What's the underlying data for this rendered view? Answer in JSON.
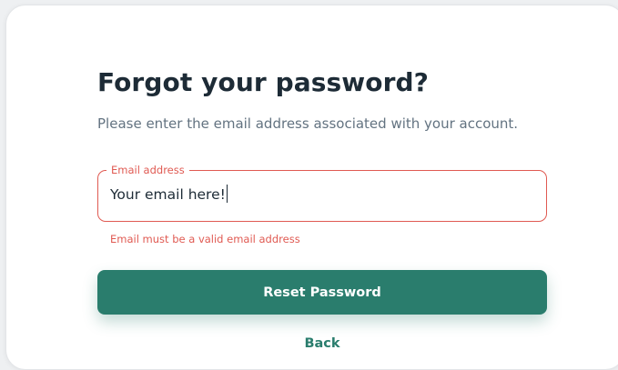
{
  "form": {
    "title": "Forgot your password?",
    "subtitle": "Please enter the email address associated with your account.",
    "email_field": {
      "label": "Email address",
      "value": "Your email here!",
      "error": "Email must be a valid email address"
    },
    "submit_label": "Reset Password",
    "back_label": "Back"
  },
  "colors": {
    "accent": "#2a7d6d",
    "error": "#e05a52",
    "heading": "#1d2b36",
    "muted": "#637381"
  }
}
